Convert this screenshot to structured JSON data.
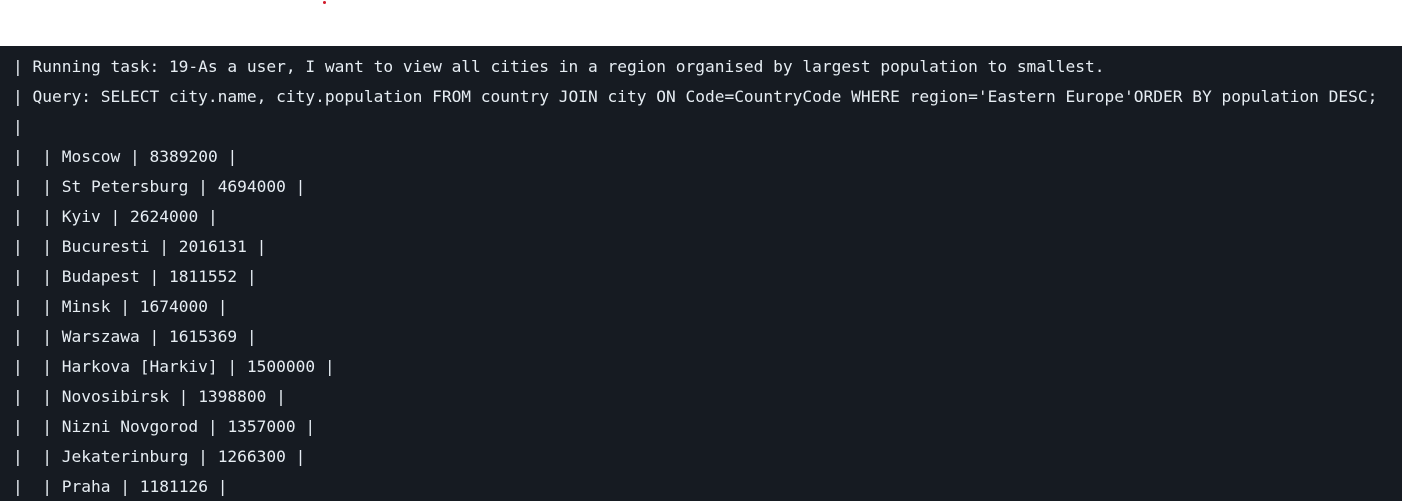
{
  "terminal": {
    "running_task": "Running task: 19-As a user, I want to view all cities in a region organised by largest population to smallest.",
    "query": "Query: SELECT city.name, city.population FROM country JOIN city ON Code=CountryCode WHERE region='Eastern Europe'ORDER BY population DESC;",
    "rows": [
      {
        "name": "Moscow",
        "population": "8389200"
      },
      {
        "name": "St Petersburg",
        "population": "4694000"
      },
      {
        "name": "Kyiv",
        "population": "2624000"
      },
      {
        "name": "Bucuresti",
        "population": "2016131"
      },
      {
        "name": "Budapest",
        "population": "1811552"
      },
      {
        "name": "Minsk",
        "population": "1674000"
      },
      {
        "name": "Warszawa",
        "population": "1615369"
      },
      {
        "name": "Harkova [Harkiv]",
        "population": "1500000"
      },
      {
        "name": "Novosibirsk",
        "population": "1398800"
      },
      {
        "name": "Nizni Novgorod",
        "population": "1357000"
      },
      {
        "name": "Jekaterinburg",
        "population": "1266300"
      },
      {
        "name": "Praha",
        "population": "1181126"
      }
    ]
  },
  "colors": {
    "terminal_bg": "#161b22",
    "terminal_text": "#e6edf3",
    "page_bg": "#ffffff",
    "dot": "#d11a2a"
  }
}
